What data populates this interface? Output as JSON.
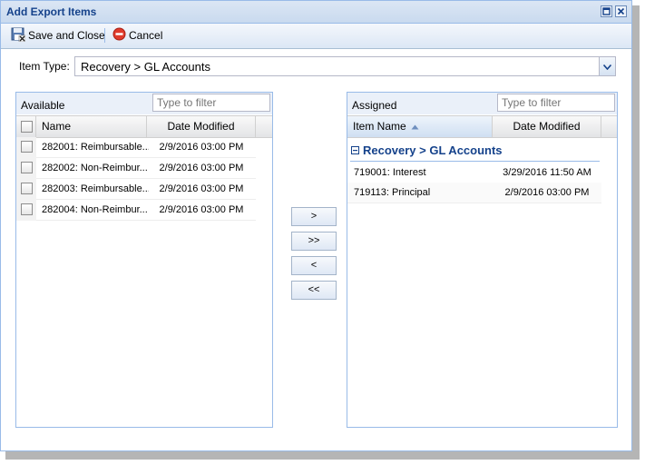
{
  "window": {
    "title": "Add Export Items"
  },
  "toolbar": {
    "save_label": "Save and Close",
    "cancel_label": "Cancel"
  },
  "item_type": {
    "label": "Item Type:",
    "value": "Recovery > GL Accounts"
  },
  "available": {
    "title": "Available",
    "filter_placeholder": "Type to filter",
    "columns": {
      "name": "Name",
      "date": "Date Modified"
    },
    "rows": [
      {
        "name": "282001: Reimbursable...",
        "date": "2/9/2016 03:00 PM"
      },
      {
        "name": "282002: Non-Reimbur...",
        "date": "2/9/2016 03:00 PM"
      },
      {
        "name": "282003: Reimbursable...",
        "date": "2/9/2016 03:00 PM"
      },
      {
        "name": "282004: Non-Reimbur...",
        "date": "2/9/2016 03:00 PM"
      }
    ]
  },
  "move_buttons": {
    "add_one": ">",
    "add_all": ">>",
    "remove_one": "<",
    "remove_all": "<<"
  },
  "assigned": {
    "title": "Assigned",
    "filter_placeholder": "Type to filter",
    "columns": {
      "name": "Item Name",
      "date": "Date Modified"
    },
    "group": "Recovery > GL Accounts",
    "rows": [
      {
        "name": "719001: Interest",
        "date": "3/29/2016 11:50 AM"
      },
      {
        "name": "719113: Principal",
        "date": "2/9/2016 03:00 PM"
      }
    ]
  },
  "colors": {
    "title_text": "#15428b",
    "border": "#99bbe8",
    "panel_bg": "#dfe8f6",
    "cancel_icon": "#e03b2c"
  }
}
